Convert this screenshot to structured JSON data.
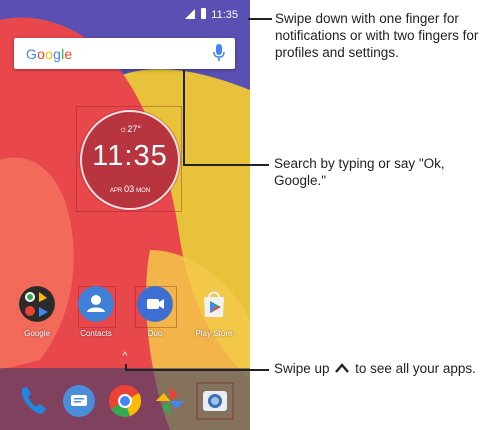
{
  "status_bar": {
    "time": "11:35"
  },
  "search_bar": {
    "logo": "Google"
  },
  "clock_widget": {
    "weather": "27°",
    "time": "11:35",
    "date_month": "APR",
    "date_day": "03",
    "date_weekday": "MON"
  },
  "apps": [
    {
      "label": "Google"
    },
    {
      "label": "Contacts"
    },
    {
      "label": "Duo"
    },
    {
      "label": "Play Store"
    }
  ],
  "swipe_up_indicator": "^",
  "dock": [
    {
      "icon": "phone-icon"
    },
    {
      "icon": "messages-icon"
    },
    {
      "icon": "chrome-icon"
    },
    {
      "icon": "photos-icon"
    },
    {
      "icon": "camera-icon"
    }
  ],
  "callouts": {
    "notifications": "Swipe down with one finger for notifications or with two fingers for profiles and settings.",
    "search": "Search by typing or say \"Ok, Google.\"",
    "apps_before": "Swipe up",
    "apps_after": "to see all your apps."
  }
}
